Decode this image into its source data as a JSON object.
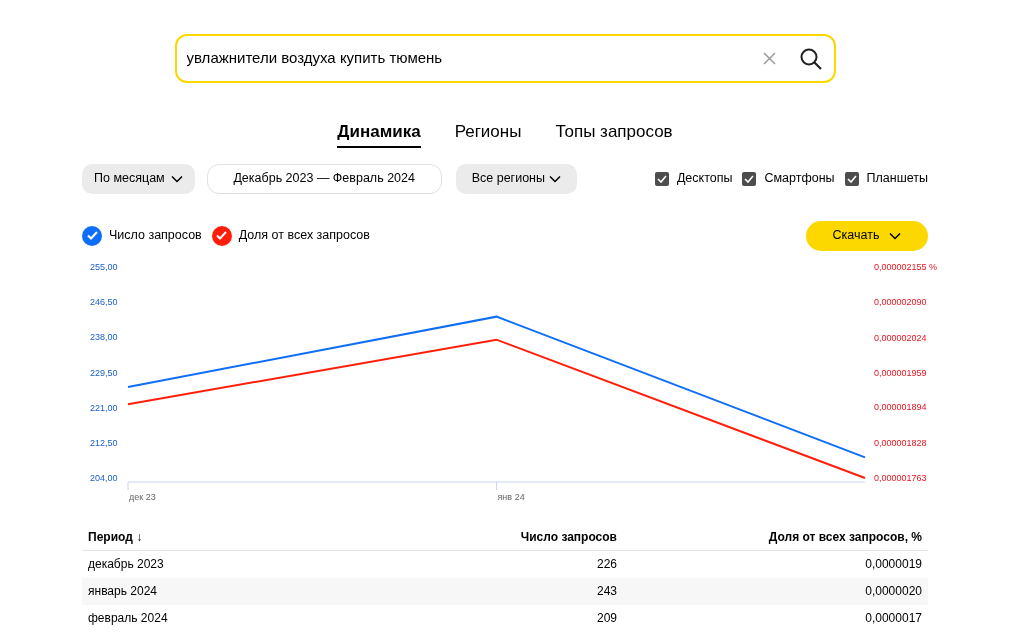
{
  "search": {
    "value": "увлажнители воздуха купить тюмень"
  },
  "tabs": [
    {
      "label": "Динамика",
      "selected": true
    },
    {
      "label": "Регионы",
      "selected": false
    },
    {
      "label": "Топы запросов",
      "selected": false
    }
  ],
  "filters": {
    "period": "По месяцам",
    "range": "Декабрь 2023 — Февраль 2024",
    "regions": "Все регионы"
  },
  "devices": [
    {
      "label": "Десктопы",
      "checked": true
    },
    {
      "label": "Смартфоны",
      "checked": true
    },
    {
      "label": "Планшеты",
      "checked": true
    }
  ],
  "legend": [
    {
      "checked": true
    },
    {
      "checked": true
    }
  ],
  "download_button": "Скачать",
  "chart_data": {
    "type": "line",
    "categories": [
      "дек 23",
      "янв 24",
      null
    ],
    "ylim": [
      204,
      255
    ],
    "yticks": [
      {
        "value": 255,
        "label": "255,00"
      },
      {
        "value": 246.5,
        "label": "246,50"
      },
      {
        "value": 238,
        "label": "238,00"
      },
      {
        "value": 229.5,
        "label": "229,50"
      },
      {
        "value": 221,
        "label": "221,00"
      },
      {
        "value": 212.5,
        "label": "212,50"
      },
      {
        "value": 204,
        "label": "204,00"
      }
    ],
    "y2lim": [
      1.763e-06,
      2.155e-06
    ],
    "y2ticks": [
      {
        "value": 2.155e-06,
        "label": "0,000002155 %"
      },
      {
        "value": 2.09e-06,
        "label": "0,000002090"
      },
      {
        "value": 2.024e-06,
        "label": "0,000002024"
      },
      {
        "value": 1.959e-06,
        "label": "0,000001959"
      },
      {
        "value": 1.894e-06,
        "label": "0,000001894"
      },
      {
        "value": 1.828e-06,
        "label": "0,000001828"
      },
      {
        "value": 1.763e-06,
        "label": "0,000001763"
      }
    ],
    "series": [
      {
        "name": "Число запросов",
        "color": "#0f6ef7",
        "values": [
          226,
          243,
          209
        ]
      },
      {
        "name": "Доля от всех запросов",
        "color": "#ff1e0a",
        "axis": "y2",
        "values": [
          1.9e-06,
          2.02e-06,
          1.763e-06
        ]
      }
    ]
  },
  "table": {
    "columns": [
      "Период ↓",
      "Число запросов",
      "Доля от всех запросов, %"
    ],
    "rows": [
      [
        "декабрь 2023",
        "226",
        "0,0000019"
      ],
      [
        "январь 2024",
        "243",
        "0,0000020"
      ],
      [
        "февраль 2024",
        "209",
        "0,0000017"
      ]
    ]
  }
}
